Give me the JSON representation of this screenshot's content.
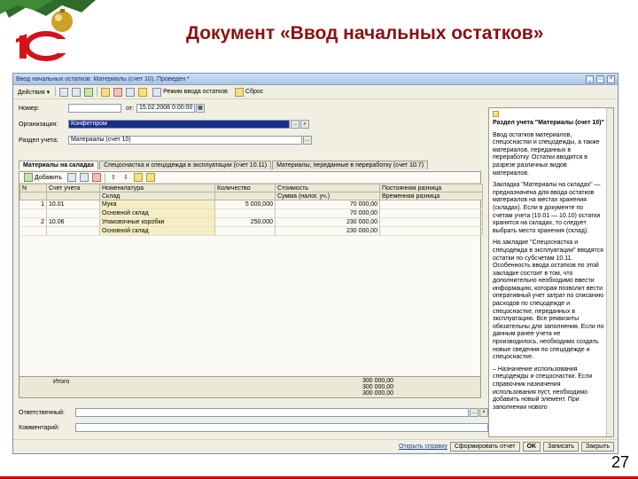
{
  "slide": {
    "title": "Документ «Ввод начальных остатков»",
    "page_number": "27",
    "logo_text": "1С"
  },
  "window": {
    "title": "Ввод начальных остатков: Материалы (счет 10). Проведен *",
    "controls": [
      "_",
      "□",
      "×"
    ]
  },
  "toolbar": {
    "actions_label": "Действия ▾",
    "fill_label": "Режим ввода остатков",
    "help_label": "Сброс"
  },
  "form": {
    "number_label": "Номер:",
    "number_value": "",
    "date_label": "от:",
    "date_value": "15.02.2008 0:00:00",
    "org_label": "Организация:",
    "org_value": "Конфетпром",
    "section_label": "Раздел учета:",
    "section_value": "Материалы (счет 10)"
  },
  "tabs": [
    {
      "label": "Материалы на складах"
    },
    {
      "label": "Спецоснастка и спецодежда в эксплуатации (счет 10.11)"
    },
    {
      "label": "Материалы, переданные в переработку (счет 10.7)"
    }
  ],
  "table_toolbar": {
    "add_label": "Добавить"
  },
  "grid": {
    "headers_row1": [
      "N",
      "Счет учета",
      "Номенклатура",
      "Количество",
      "Стоимость",
      "Постоянная разница"
    ],
    "headers_row2": [
      "",
      "",
      "Склад",
      "",
      "Сумма (налог. уч.)",
      "Временная разница"
    ],
    "rows": [
      {
        "n": "1",
        "account": "10.01",
        "item": "Мука",
        "qty": "5 000,000",
        "cost": "70 000,00",
        "diff": ""
      },
      {
        "n": "",
        "account": "",
        "item": "Основной склад",
        "qty": "",
        "cost": "70 000,00",
        "diff": ""
      },
      {
        "n": "2",
        "account": "10.06",
        "item": "Упаковочные коробки",
        "qty": "250,000",
        "cost": "230 000,00",
        "diff": ""
      },
      {
        "n": "",
        "account": "",
        "item": "Основной склад",
        "qty": "",
        "cost": "230 000,00",
        "diff": ""
      }
    ],
    "totals_label": "Итого",
    "totals_values": [
      "300 000,00",
      "300 000,00",
      "300 000,00"
    ]
  },
  "bottom": {
    "responsible_label": "Ответственный:",
    "responsible_value": "",
    "comment_label": "Комментарий:",
    "comment_value": ""
  },
  "help_panel": {
    "paragraphs": [
      "Раздел учета \"Материалы (счет 10)\"",
      "Ввод остатков материалов, спецоснастки и спецодежды, а также материалов, переданных в переработку. Остатки вводятся в разрезе различных видов материалов.",
      "Закладка \"Материалы на складах\" — предназначена для ввода остатков материалов на местах хранения (складах). Если в документе по счетам учета (10.01 — 10.10) остатки хранятся на складах, то следует выбрать место хранения (склад).",
      "На закладке \"Спецоснастка и спецодежда в эксплуатации\" вводятся остатки по субсчетам 10.11. Особенность ввода остатков по этой закладке состоит в том, что дополнительно необходимо ввести информацию, которая позволит вести оперативный учет затрат по списанию расходов по спецодежде и спецоснастке, переданных в эксплуатацию. Все реквизиты обязательны для заполнения. Если по данным ранее учета не производилось, необходимо создать новые сведения по спецодежде и спецоснастке.",
      "– Назначение использования спецодежды и спецоснастки. Если справочник назначения использования пуст, необходимо добавить новый элемент. При заполнении нового"
    ],
    "link_label": "Открыть справку"
  },
  "footer": {
    "buttons": [
      "Сформировать отчет",
      "OK",
      "Записать",
      "Закрыть"
    ]
  },
  "colors": {
    "title": "#8b1111",
    "selection": "#1c2e8a",
    "highlight": "#f7efc4",
    "titlebar": "#a9c3e6"
  }
}
